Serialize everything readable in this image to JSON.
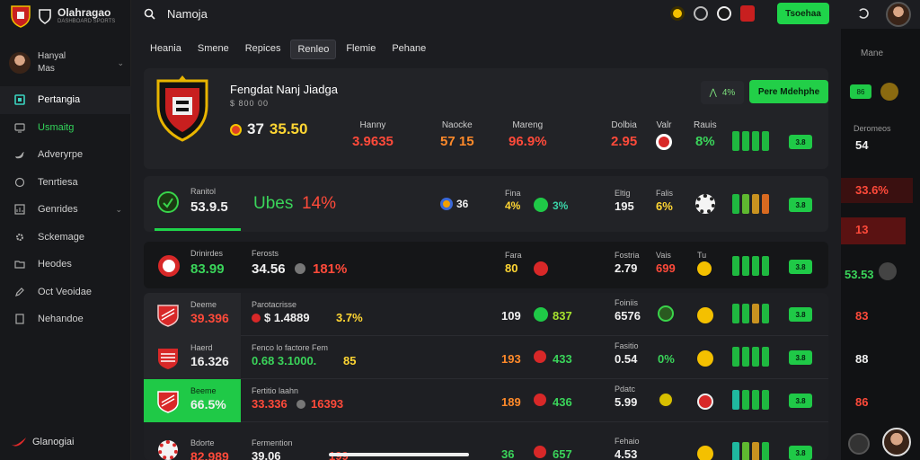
{
  "app": {
    "brand": "Olahragao",
    "brand_sub": "DASHBOARD SPORTS"
  },
  "user": {
    "name_line1": "Hanyal",
    "name_line2": "Mas"
  },
  "sidebar": {
    "items": [
      {
        "label": "Pertangia",
        "icon": "square-icon",
        "active": true
      },
      {
        "label": "Usmaitg",
        "icon": "monitor-icon",
        "green": true
      },
      {
        "label": "Adveryrpe",
        "icon": "bird-icon"
      },
      {
        "label": "Tenrtiesa",
        "icon": "chat-icon"
      },
      {
        "label": "Genrides",
        "icon": "chart-icon",
        "expand": true
      },
      {
        "label": "Sckemage",
        "icon": "gear-icon"
      },
      {
        "label": "Heodes",
        "icon": "folder-icon"
      },
      {
        "label": "Oct Veoidae",
        "icon": "edit-icon"
      },
      {
        "label": "Nehandoe",
        "icon": "doc-icon"
      }
    ],
    "bottom": "Glanogiai"
  },
  "search": {
    "text": "Namoja"
  },
  "topbar": {
    "button": "Tsoehaa"
  },
  "tabs": [
    "Heania",
    "Smene",
    "Repices",
    "Renleo",
    "Flemie",
    "Pehane"
  ],
  "hero": {
    "title": "Fengdat Nanj Jiadga",
    "sub": "$ 800 00",
    "score_a": "37",
    "score_b": "35.50",
    "share_label": "4%",
    "main_button": "Pere Mdehphe",
    "cols": [
      {
        "label": "Hanny",
        "value": "3.9635"
      },
      {
        "label": "Naocke",
        "value": "57 15"
      },
      {
        "label": "Mareng",
        "value": "96.9%"
      },
      {
        "label": "Dolbia",
        "value": "2.95"
      },
      {
        "label": "Valr",
        "value": ""
      },
      {
        "label": "Rauis",
        "value": "8%"
      }
    ],
    "chip": "3.8",
    "colors": {
      "green": "#22cf48",
      "red": "#ff4a3a"
    }
  },
  "row1": {
    "label": "Ranitol",
    "value": "53.9.5",
    "big_green": "Ubes",
    "big_red": "14%",
    "mid_val": "36",
    "pct1_label": "Fina",
    "pct1": "4%",
    "pct2": "3%",
    "col_label": "Eltig",
    "col_val": "195",
    "pct3_label": "Falis",
    "pct3": "6%",
    "chip": "3.8"
  },
  "row2": {
    "label": "Drinirdes",
    "value": "83.99",
    "label2": "Ferosts",
    "value2": "34.56",
    "value3": "181%",
    "fin_label": "Fara",
    "fin_val": "80",
    "col_label": "Fostria",
    "col_val": "2.79",
    "pct_label": "Vais",
    "pct": "699",
    "num_label": "Tu",
    "chip": "3.8"
  },
  "table": [
    {
      "label": "Deeme",
      "value": "39.396",
      "label2": "Parotacrisse",
      "value2": "$ 1.4889",
      "value3": "3.7%",
      "mid": "109",
      "mid2": "837",
      "col_label": "Foiniis",
      "col_val": "6576",
      "chip": "3.8"
    },
    {
      "label": "Haerd",
      "value": "16.326",
      "label2": "Fenco lo factore Fem",
      "value2": "0.68 3.1000.",
      "value3": "85",
      "mid": "193",
      "mid2": "433",
      "col_label": "Fasitio",
      "col_val": "0.54",
      "pct": "0%",
      "chip": "3.8"
    },
    {
      "label": "Beeme",
      "value": "66.5%",
      "label2": "Fertitio laahn",
      "value2": "33.336",
      "value3": "16393",
      "mid": "189",
      "mid2": "436",
      "col_label": "Pdatc",
      "col_val": "5.99",
      "chip": "3.8"
    },
    {
      "label": "Bdorte",
      "value": "82.989",
      "label2": "Fermention",
      "value2": "39.06",
      "value3": "199",
      "mid": "36",
      "mid2": "657",
      "col_label": "Fehaio",
      "col_val": "4.53",
      "chip": "3.8"
    }
  ],
  "right_panel": {
    "tab": "Mane",
    "chip": "86",
    "items": [
      {
        "label": "Deromeos",
        "value": "54"
      },
      {
        "label": "",
        "value": "33.6%"
      },
      {
        "label": "",
        "value": "13"
      },
      {
        "label": "",
        "value": "53.53"
      },
      {
        "label": "",
        "value": "83"
      },
      {
        "label": "",
        "value": "88"
      },
      {
        "label": "",
        "value": "86"
      }
    ]
  }
}
